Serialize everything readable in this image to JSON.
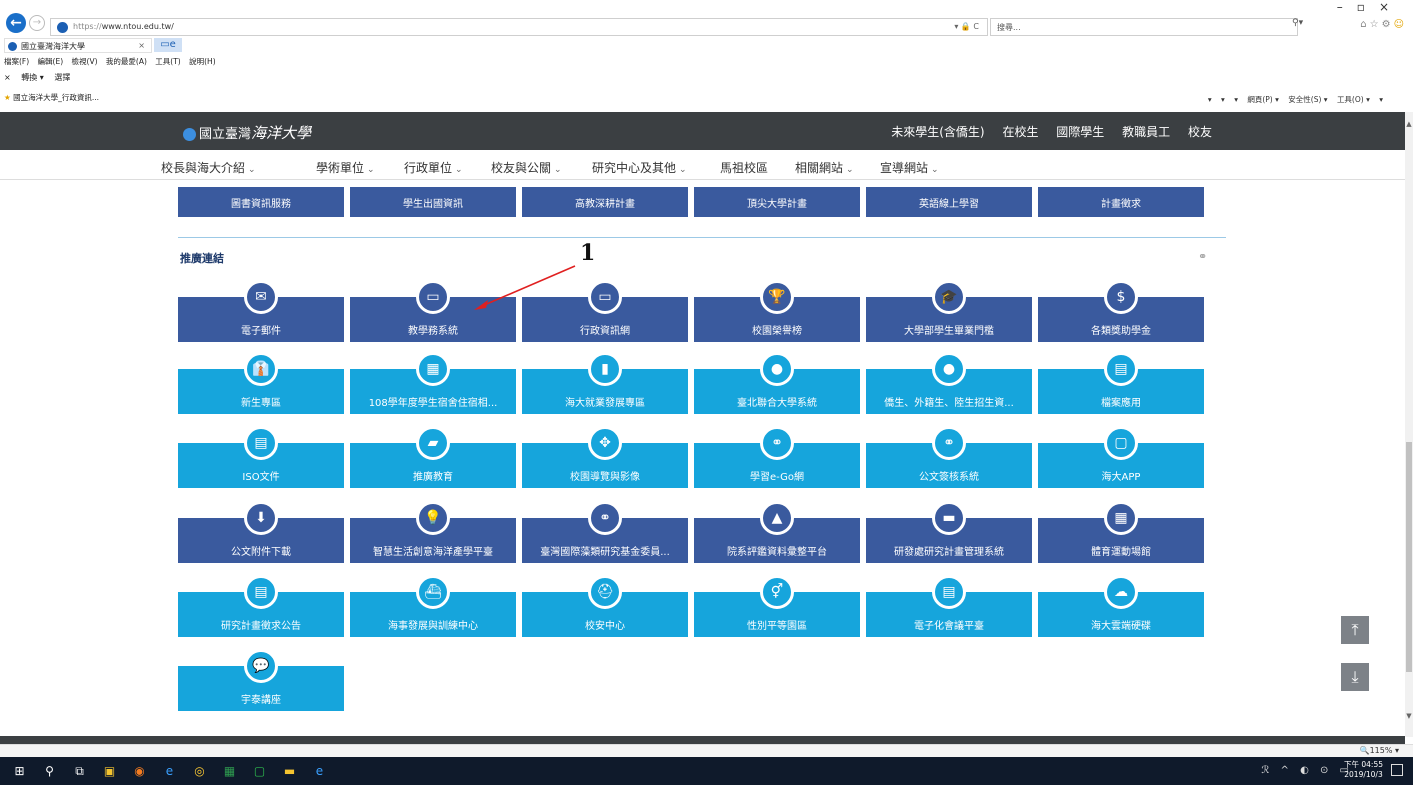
{
  "browser": {
    "url_scheme": "https://",
    "url_host": "www.ntou.edu.tw/",
    "address_controls": "▾ 🔒 C",
    "search_placeholder": "搜尋...",
    "tab_title": "國立臺灣海洋大學",
    "menu": [
      "檔案(F)",
      "編輯(E)",
      "檢視(V)",
      "我的最愛(A)",
      "工具(T)",
      "說明(H)"
    ],
    "command_bar": [
      "×",
      "轉換 ▾",
      "選擇"
    ],
    "favorites": "國立海洋大學_行政資訊...",
    "toolbar_right": [
      "▾",
      "▾",
      "▾",
      "網頁(P) ▾",
      "安全性(S) ▾",
      "工具(O) ▾",
      "▾"
    ],
    "zoom": "🔍115%  ▾"
  },
  "site": {
    "logo_text": "國立臺灣",
    "logo_script": "海洋大學",
    "audience_links": [
      "未來學生(含僑生)",
      "在校生",
      "國際學生",
      "教職員工",
      "校友"
    ],
    "nav": [
      "校長與海大介紹",
      "學術單位",
      "行政單位",
      "校友與公關",
      "研究中心及其他",
      "馬祖校區",
      "相關網站",
      "宣導網站"
    ],
    "nav_has_dropdown": [
      true,
      true,
      true,
      true,
      true,
      false,
      true,
      true
    ],
    "top_tiles": [
      "圖書資訊服務",
      "學生出國資訊",
      "高教深耕計畫",
      "頂尖大學計畫",
      "英語線上學習",
      "計畫徵求"
    ],
    "section_title": "推廣連結",
    "section_link_icon": "link-icon",
    "rows": [
      {
        "style": "dark",
        "tiles": [
          {
            "label": "電子郵件",
            "icon": "✉"
          },
          {
            "label": "教學務系統",
            "icon": "▭"
          },
          {
            "label": "行政資訊網",
            "icon": "▭"
          },
          {
            "label": "校園榮譽榜",
            "icon": "🏆"
          },
          {
            "label": "大學部學生畢業門檻",
            "icon": "🎓"
          },
          {
            "label": "各類獎助學金",
            "icon": "$"
          }
        ]
      },
      {
        "style": "light",
        "tiles": [
          {
            "label": "新生專區",
            "icon": "👔"
          },
          {
            "label": "108學年度學生宿舍住宿相...",
            "icon": "▦"
          },
          {
            "label": "海大就業發展專區",
            "icon": "▮"
          },
          {
            "label": "臺北聯合大學系統",
            "icon": "●"
          },
          {
            "label": "僑生、外籍生、陸生招生資...",
            "icon": "●"
          },
          {
            "label": "檔案應用",
            "icon": "▤"
          }
        ]
      },
      {
        "style": "light",
        "tiles": [
          {
            "label": "ISO文件",
            "icon": "▤"
          },
          {
            "label": "推廣教育",
            "icon": "▰"
          },
          {
            "label": "校園導覽與影像",
            "icon": "✥"
          },
          {
            "label": "學習e-Go網",
            "icon": "⚭"
          },
          {
            "label": "公文簽核系統",
            "icon": "⚭"
          },
          {
            "label": "海大APP",
            "icon": "▢"
          }
        ]
      },
      {
        "style": "dark",
        "tiles": [
          {
            "label": "公文附件下載",
            "icon": "⬇"
          },
          {
            "label": "智慧生活創意海洋產學平臺",
            "icon": "💡"
          },
          {
            "label": "臺灣國際藻類研究基金委員...",
            "icon": "⚭"
          },
          {
            "label": "院系評鑑資料彙整平台",
            "icon": "▲"
          },
          {
            "label": "研發處研究計畫管理系統",
            "icon": "▬"
          },
          {
            "label": "體育運動場館",
            "icon": "▦"
          }
        ]
      },
      {
        "style": "light",
        "tiles": [
          {
            "label": "研究計畫徵求公告",
            "icon": "▤"
          },
          {
            "label": "海事發展與訓練中心",
            "icon": "⛴"
          },
          {
            "label": "校安中心",
            "icon": "⛑"
          },
          {
            "label": "性別平等園區",
            "icon": "⚥"
          },
          {
            "label": "電子化會議平臺",
            "icon": "▤"
          },
          {
            "label": "海大雲端硬碟",
            "icon": "☁"
          }
        ]
      },
      {
        "style": "light",
        "tiles": [
          {
            "label": "宇泰講座",
            "icon": "💬"
          }
        ]
      }
    ],
    "annotation_number": "1",
    "annotation_color": "#e02020"
  },
  "taskbar": {
    "icons": [
      "⊞",
      "⚲",
      "⧉",
      "▣",
      "◉",
      "e",
      "◎",
      "▦",
      "▢",
      "▬",
      "e"
    ],
    "tray": "ℛ ^ ◐ ⊙ ▭",
    "time": "下午 04:55",
    "date": "2019/10/3"
  },
  "colors": {
    "header_bg": "#3b3f42",
    "tile_dark": "#3a5a9e",
    "tile_light": "#16a5dc"
  }
}
